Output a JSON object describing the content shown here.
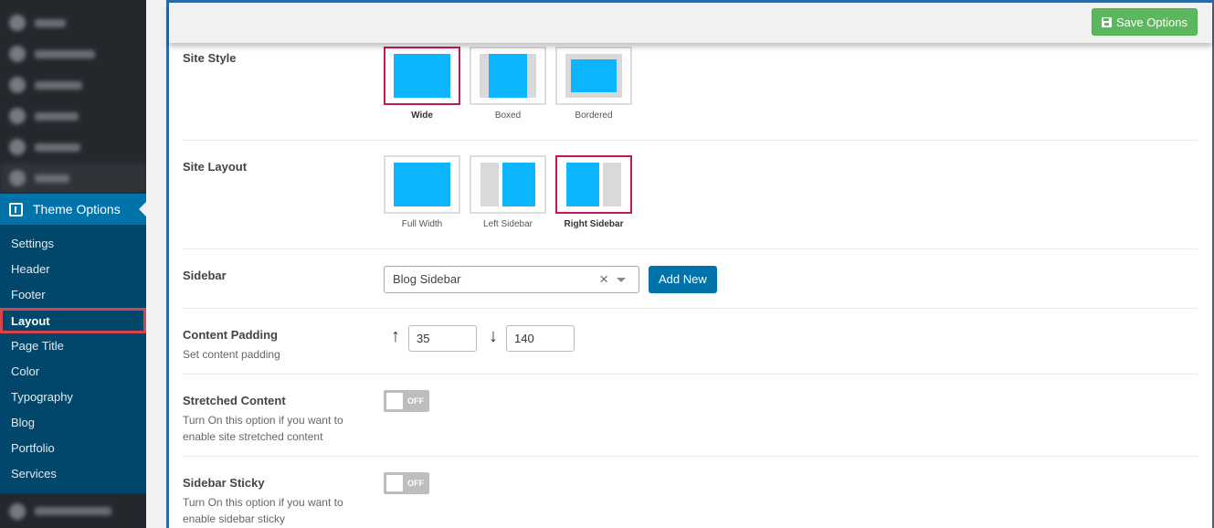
{
  "sidebar": {
    "active_menu": "Theme Options",
    "submenu": [
      "Settings",
      "Header",
      "Footer",
      "Layout",
      "Page Title",
      "Color",
      "Typography",
      "Blog",
      "Portfolio",
      "Services"
    ],
    "current_item": "Layout"
  },
  "toolbar": {
    "save_label": "Save Options"
  },
  "site_style": {
    "label": "Site Style",
    "options": [
      "Wide",
      "Boxed",
      "Bordered"
    ],
    "selected": "Wide"
  },
  "site_layout": {
    "label": "Site Layout",
    "options": [
      "Full Width",
      "Left Sidebar",
      "Right Sidebar"
    ],
    "selected": "Right Sidebar"
  },
  "sidebar_field": {
    "label": "Sidebar",
    "value": "Blog Sidebar",
    "clear_symbol": "×",
    "add_label": "Add New"
  },
  "content_padding": {
    "label": "Content Padding",
    "description": "Set content padding",
    "top": "35",
    "bottom": "140"
  },
  "stretched_content": {
    "label": "Stretched Content",
    "description": "Turn On this option if you want to enable site stretched content",
    "state": "OFF"
  },
  "sidebar_sticky": {
    "label": "Sidebar Sticky",
    "description": "Turn On this option if you want to enable sidebar sticky",
    "state": "OFF"
  },
  "colors": {
    "accent": "#0073aa",
    "submenu_bg": "#00476b",
    "selected_border": "#c2185b",
    "preview_blue": "#0cb5ff",
    "save_green": "#5cb85c"
  }
}
